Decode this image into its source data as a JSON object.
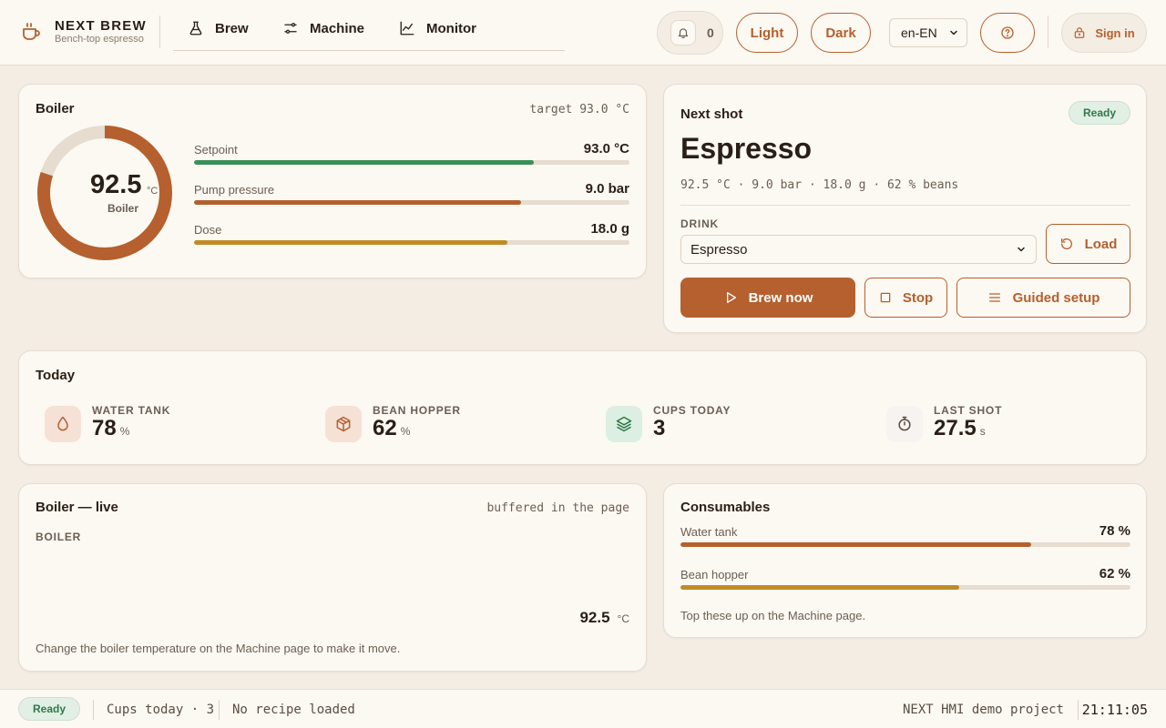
{
  "brand": {
    "title": "NEXT BREW",
    "subtitle": "Bench-top espresso",
    "icon": "coffee-cup-icon"
  },
  "nav": {
    "items": [
      {
        "label": "Brew",
        "icon": "flask-icon"
      },
      {
        "label": "Machine",
        "icon": "sliders-icon"
      },
      {
        "label": "Monitor",
        "icon": "chart-line-icon"
      }
    ]
  },
  "header": {
    "notifications_count": "0",
    "theme_light": "Light",
    "theme_dark": "Dark",
    "language": "en-EN",
    "sign_in": "Sign in"
  },
  "boiler_card": {
    "title": "Boiler",
    "target": "target 93.0 °C",
    "gauge_value": "92.5",
    "gauge_unit": "°C",
    "gauge_label": "Boiler",
    "gauge_fraction": 0.8,
    "bars": [
      {
        "label": "Setpoint",
        "value": "93.0 °C",
        "fraction": 0.78,
        "color": "#3a8f58"
      },
      {
        "label": "Pump pressure",
        "value": "9.0 bar",
        "fraction": 0.75,
        "color": "#b5602e"
      },
      {
        "label": "Dose",
        "value": "18.0 g",
        "fraction": 0.72,
        "color": "#c08a25"
      }
    ]
  },
  "next_shot": {
    "title": "Next shot",
    "status": "Ready",
    "drink_name": "Espresso",
    "summary": "92.5 °C · 9.0 bar · 18.0 g · 62 % beans",
    "drink_label": "DRINK",
    "drink_selected": "Espresso",
    "load": "Load",
    "brew_now": "Brew now",
    "stop": "Stop",
    "guided_setup": "Guided setup"
  },
  "today": {
    "title": "Today",
    "stats": [
      {
        "label": "WATER TANK",
        "value": "78",
        "unit": "%",
        "icon": "water-drop-icon"
      },
      {
        "label": "BEAN HOPPER",
        "value": "62",
        "unit": "%",
        "icon": "box-icon"
      },
      {
        "label": "CUPS TODAY",
        "value": "3",
        "unit": "",
        "icon": "layers-icon"
      },
      {
        "label": "LAST SHOT",
        "value": "27.5",
        "unit": "s",
        "icon": "stopwatch-icon"
      }
    ]
  },
  "live": {
    "title": "Boiler — live",
    "note": "buffered in the page",
    "series_label": "BOILER",
    "value": "92.5",
    "unit": "°C",
    "hint": "Change the boiler temperature on the Machine page to make it move."
  },
  "consumables": {
    "title": "Consumables",
    "items": [
      {
        "label": "Water tank",
        "value": "78 %",
        "fraction": 0.78,
        "color": "#b5602e"
      },
      {
        "label": "Bean hopper",
        "value": "62 %",
        "fraction": 0.62,
        "color": "#c08a25"
      }
    ],
    "hint": "Top these up on the Machine page."
  },
  "statusbar": {
    "status": "Ready",
    "cups": "Cups today · 3",
    "recipe": "No recipe loaded",
    "project": "NEXT HMI demo project",
    "time": "21:11:05"
  }
}
